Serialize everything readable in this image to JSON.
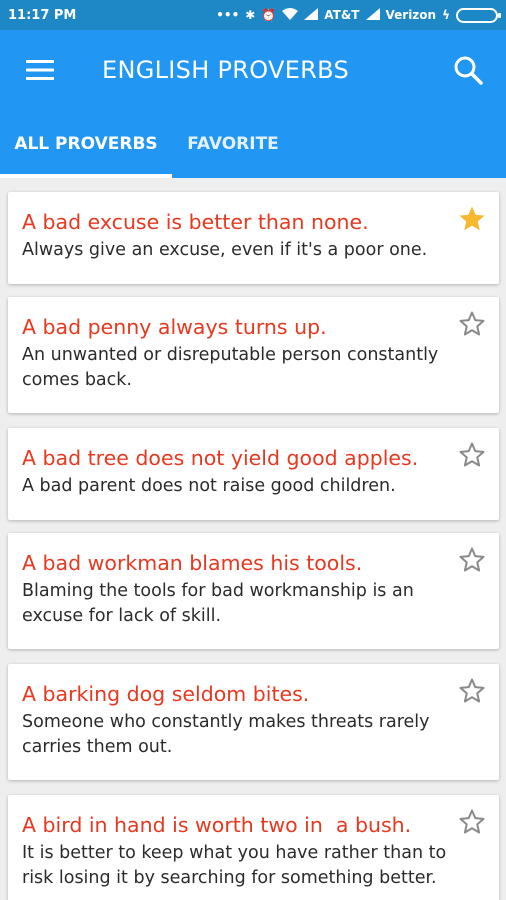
{
  "status_bar": {
    "time": "11:17 PM",
    "carrier1": "AT&T",
    "carrier2": "Verizon",
    "icons": [
      "more-dots-icon",
      "bluetooth-icon",
      "alarm-icon",
      "wifi-icon",
      "signal-icon",
      "signal-icon",
      "charging-icon",
      "battery-icon"
    ]
  },
  "app_bar": {
    "title": "ENGLISH PROVERBS",
    "menu_icon": "hamburger-menu-icon",
    "search_icon": "search-icon"
  },
  "tabs": [
    {
      "label": "ALL PROVERBS",
      "active": true
    },
    {
      "label": "FAVORITE",
      "active": false
    }
  ],
  "colors": {
    "primary": "#2196f3",
    "status_bar": "#1e88c7",
    "proverb_text": "#e8381f",
    "star_filled": "#f5b82e",
    "star_outline": "#8a8a8a"
  },
  "proverbs": [
    {
      "text": "A bad excuse is better than none.",
      "meaning": "Always give an excuse, even if it's a poor one.",
      "favorite": true
    },
    {
      "text": "A bad penny always turns up.",
      "meaning": "An unwanted or disreputable person constantly comes back.",
      "favorite": false
    },
    {
      "text": "A bad tree does not yield good apples.",
      "meaning": "A bad parent does not raise good children.",
      "favorite": false
    },
    {
      "text": "A bad workman blames his tools.",
      "meaning": "Blaming the tools for bad workmanship is an excuse for lack of skill.",
      "favorite": false
    },
    {
      "text": "A barking dog seldom bites.",
      "meaning": "Someone who constantly makes threats rarely carries them out.",
      "favorite": false
    },
    {
      "text": "A bird in hand is worth two in  a bush.",
      "meaning": "It is better to keep what you have rather than to risk losing it by searching for something better.",
      "favorite": false
    }
  ]
}
